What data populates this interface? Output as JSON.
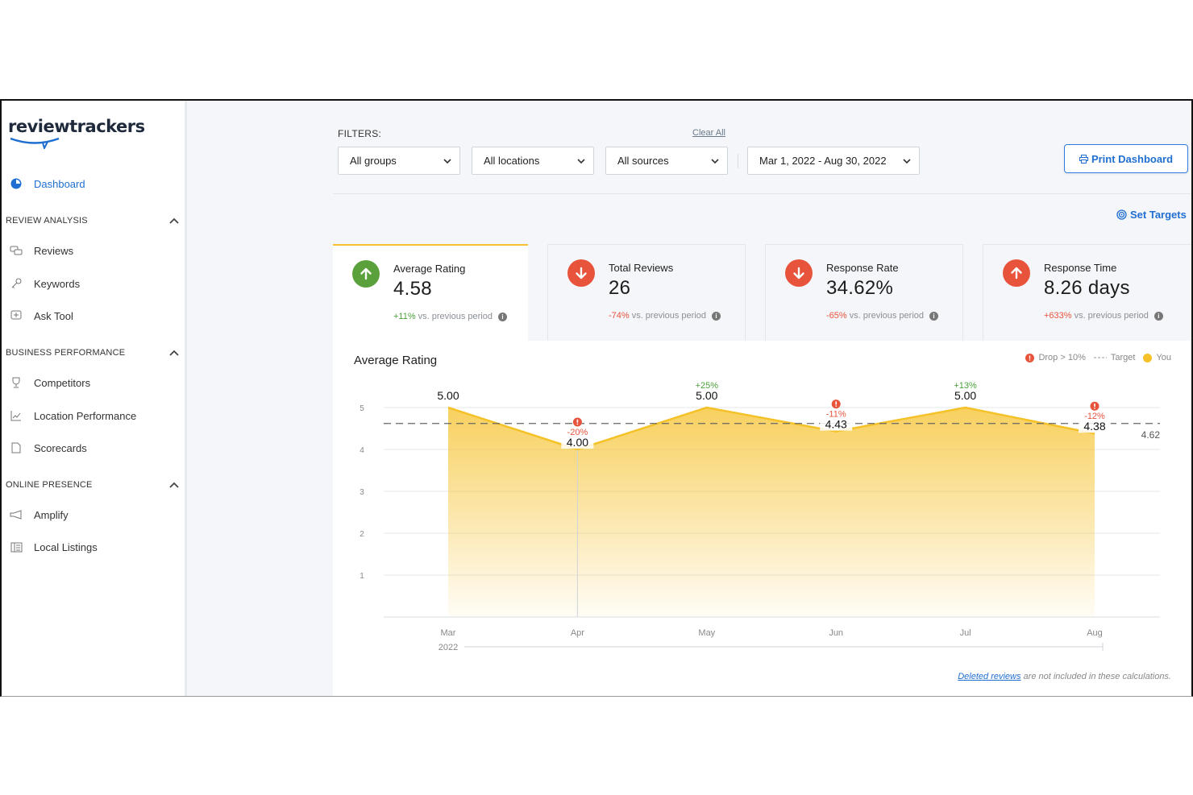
{
  "brand": {
    "name": "reviewtrackers",
    "accent": "#1f6fd1"
  },
  "sidebar": {
    "dashboard": "Dashboard",
    "sections": [
      {
        "title": "REVIEW ANALYSIS",
        "items": [
          "Reviews",
          "Keywords",
          "Ask Tool"
        ]
      },
      {
        "title": "BUSINESS PERFORMANCE",
        "items": [
          "Competitors",
          "Location Performance",
          "Scorecards"
        ]
      },
      {
        "title": "ONLINE PRESENCE",
        "items": [
          "Amplify",
          "Local Listings"
        ]
      }
    ]
  },
  "filters": {
    "label": "FILTERS:",
    "clear_all": "Clear All",
    "groups": "All groups",
    "locations": "All locations",
    "sources": "All sources",
    "date_range": "Mar 1, 2022 - Aug 30, 2022"
  },
  "actions": {
    "print": "Print Dashboard",
    "set_targets": "Set Targets"
  },
  "kpis": [
    {
      "title": "Average Rating",
      "value": "4.58",
      "change": "+11%",
      "direction": "up",
      "suffix": "vs. previous period",
      "circle_color": "#5aa13c",
      "change_color": "#4aa338"
    },
    {
      "title": "Total Reviews",
      "value": "26",
      "change": "-74%",
      "direction": "down",
      "suffix": "vs. previous period",
      "circle_color": "#e8533b",
      "change_color": "#e8533b"
    },
    {
      "title": "Response Rate",
      "value": "34.62%",
      "change": "-65%",
      "direction": "down",
      "suffix": "vs. previous period",
      "circle_color": "#e8533b",
      "change_color": "#e8533b"
    },
    {
      "title": "Response Time",
      "value": "8.26 days",
      "change": "+633%",
      "direction": "up",
      "suffix": "vs. previous period",
      "circle_color": "#e8533b",
      "change_color": "#e8533b"
    }
  ],
  "chart_data": {
    "type": "area",
    "title": "Average Rating",
    "categories": [
      "Mar",
      "Apr",
      "May",
      "Jun",
      "Jul",
      "Aug"
    ],
    "year_label": "2022",
    "values": [
      5.0,
      4.0,
      5.0,
      4.43,
      5.0,
      4.38
    ],
    "value_labels": [
      "5.00",
      "4.00",
      "5.00",
      "4.43",
      "5.00",
      "4.38"
    ],
    "changes": [
      "",
      "-20%",
      "+25%",
      "-11%",
      "+13%",
      "-12%"
    ],
    "drop_flags": [
      false,
      true,
      false,
      true,
      false,
      true
    ],
    "target": 4.62,
    "target_label": "4.62",
    "ylim": [
      0,
      5
    ],
    "yticks": [
      "1",
      "2",
      "3",
      "4",
      "5"
    ],
    "legend": {
      "drop": "Drop > 10%",
      "target": "Target",
      "you": "You"
    },
    "colors": {
      "area": "#f7c842",
      "line": "#f4c228",
      "drop": "#e8533b",
      "gain": "#4aa338"
    }
  },
  "footnote": {
    "link": "Deleted reviews",
    "text": " are not included in these calculations."
  }
}
